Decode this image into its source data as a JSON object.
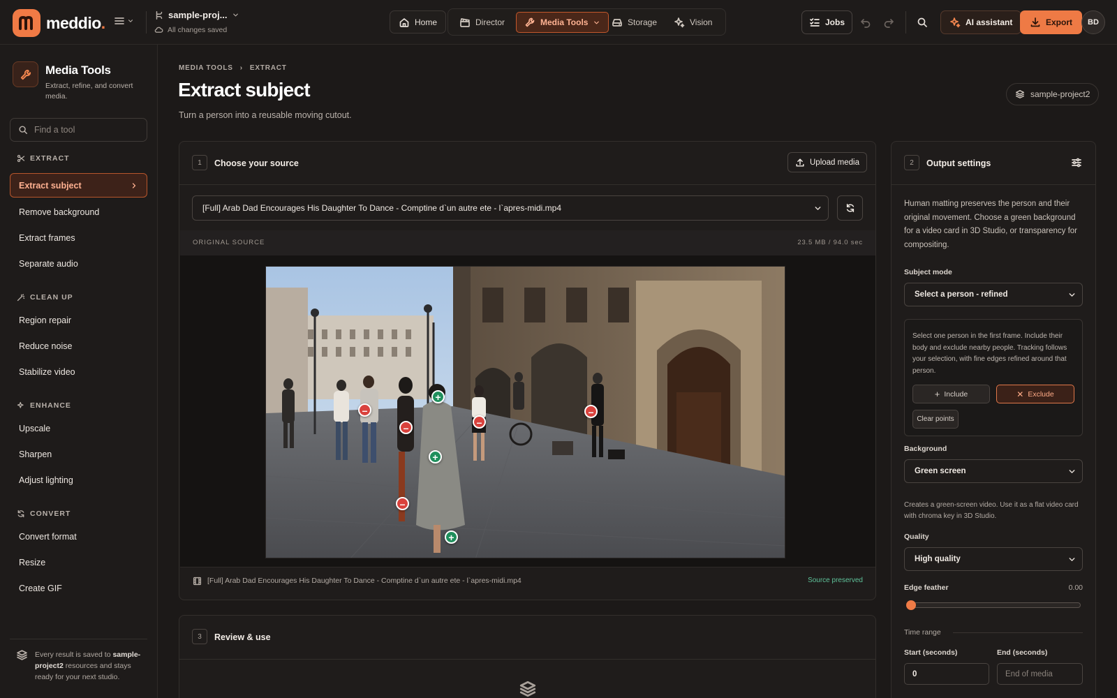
{
  "app": {
    "logo_letter": "m",
    "logo_name": "meddio",
    "logo_dot": ".",
    "project_name": "sample-proj...",
    "save_status": "All changes saved",
    "accent_color": "#ee7a45"
  },
  "nav": {
    "home": "Home",
    "director": "Director",
    "media_tools": "Media Tools",
    "storage": "Storage",
    "vision": "Vision"
  },
  "toolbar": {
    "jobs": "Jobs",
    "ai_assistant": "AI assistant",
    "export": "Export",
    "avatar_initials": "BD"
  },
  "sidebar": {
    "title": "Media Tools",
    "subtitle": "Extract, refine, and convert media.",
    "search_placeholder": "Find a tool",
    "sections": {
      "extract": {
        "label": "EXTRACT",
        "items": [
          "Extract subject",
          "Remove background",
          "Extract frames",
          "Separate audio"
        ]
      },
      "cleanup": {
        "label": "CLEAN UP",
        "items": [
          "Region repair",
          "Reduce noise",
          "Stabilize video"
        ]
      },
      "enhance": {
        "label": "ENHANCE",
        "items": [
          "Upscale",
          "Sharpen",
          "Adjust lighting"
        ]
      },
      "convert": {
        "label": "CONVERT",
        "items": [
          "Convert format",
          "Resize",
          "Create GIF"
        ]
      }
    },
    "footer": {
      "pre": "Every result is saved to ",
      "project": "sample-project2",
      "post": " resources and stays ready for your next studio."
    }
  },
  "page": {
    "breadcrumb": [
      "MEDIA TOOLS",
      "EXTRACT"
    ],
    "title": "Extract subject",
    "subtitle": "Turn a person into a reusable moving cutout.",
    "project_chip": "sample-project2"
  },
  "source": {
    "step": "1",
    "title": "Choose your source",
    "upload": "Upload media",
    "selected_file": "[Full] Arab Dad Encourages His Daughter To Dance - Comptine d`un autre ete - l`apres-midi.mp4",
    "label": "ORIGINAL SOURCE",
    "size": "23.5 MB / 94.0 sec",
    "file_name": "[Full] Arab Dad Encourages His Daughter To Dance - Comptine d`un autre ete - l`apres-midi.mp4",
    "preserved": "Source preserved",
    "points": [
      {
        "type": "include",
        "symbol": "+"
      },
      {
        "type": "include",
        "symbol": "+"
      },
      {
        "type": "include",
        "symbol": "+"
      },
      {
        "type": "exclude",
        "symbol": "–"
      },
      {
        "type": "exclude",
        "symbol": "–"
      },
      {
        "type": "exclude",
        "symbol": "–"
      },
      {
        "type": "exclude",
        "symbol": "–"
      },
      {
        "type": "exclude",
        "symbol": "–"
      }
    ]
  },
  "review": {
    "step": "3",
    "title": "Review & use"
  },
  "output": {
    "step": "2",
    "title": "Output settings",
    "description": "Human matting preserves the person and their original movement. Choose a green background for a video card in 3D Studio, or transparency for compositing.",
    "subject_mode_label": "Subject mode",
    "subject_mode_value": "Select a person - refined",
    "mode_help": "Select one person in the first frame. Include their body and exclude nearby people. Tracking follows your selection, with fine edges refined around that person.",
    "include": "Include",
    "exclude": "Exclude",
    "clear_points": "Clear points",
    "background_label": "Background",
    "background_value": "Green screen",
    "background_hint": "Creates a green-screen video. Use it as a flat video card with chroma key in 3D Studio.",
    "quality_label": "Quality",
    "quality_value": "High quality",
    "edge_label": "Edge feather",
    "edge_value": "0.00",
    "edge_fraction": 0,
    "time_label": "Time range",
    "start_label": "Start (seconds)",
    "start_value": "0",
    "end_label": "End (seconds)",
    "end_placeholder": "End of media"
  }
}
